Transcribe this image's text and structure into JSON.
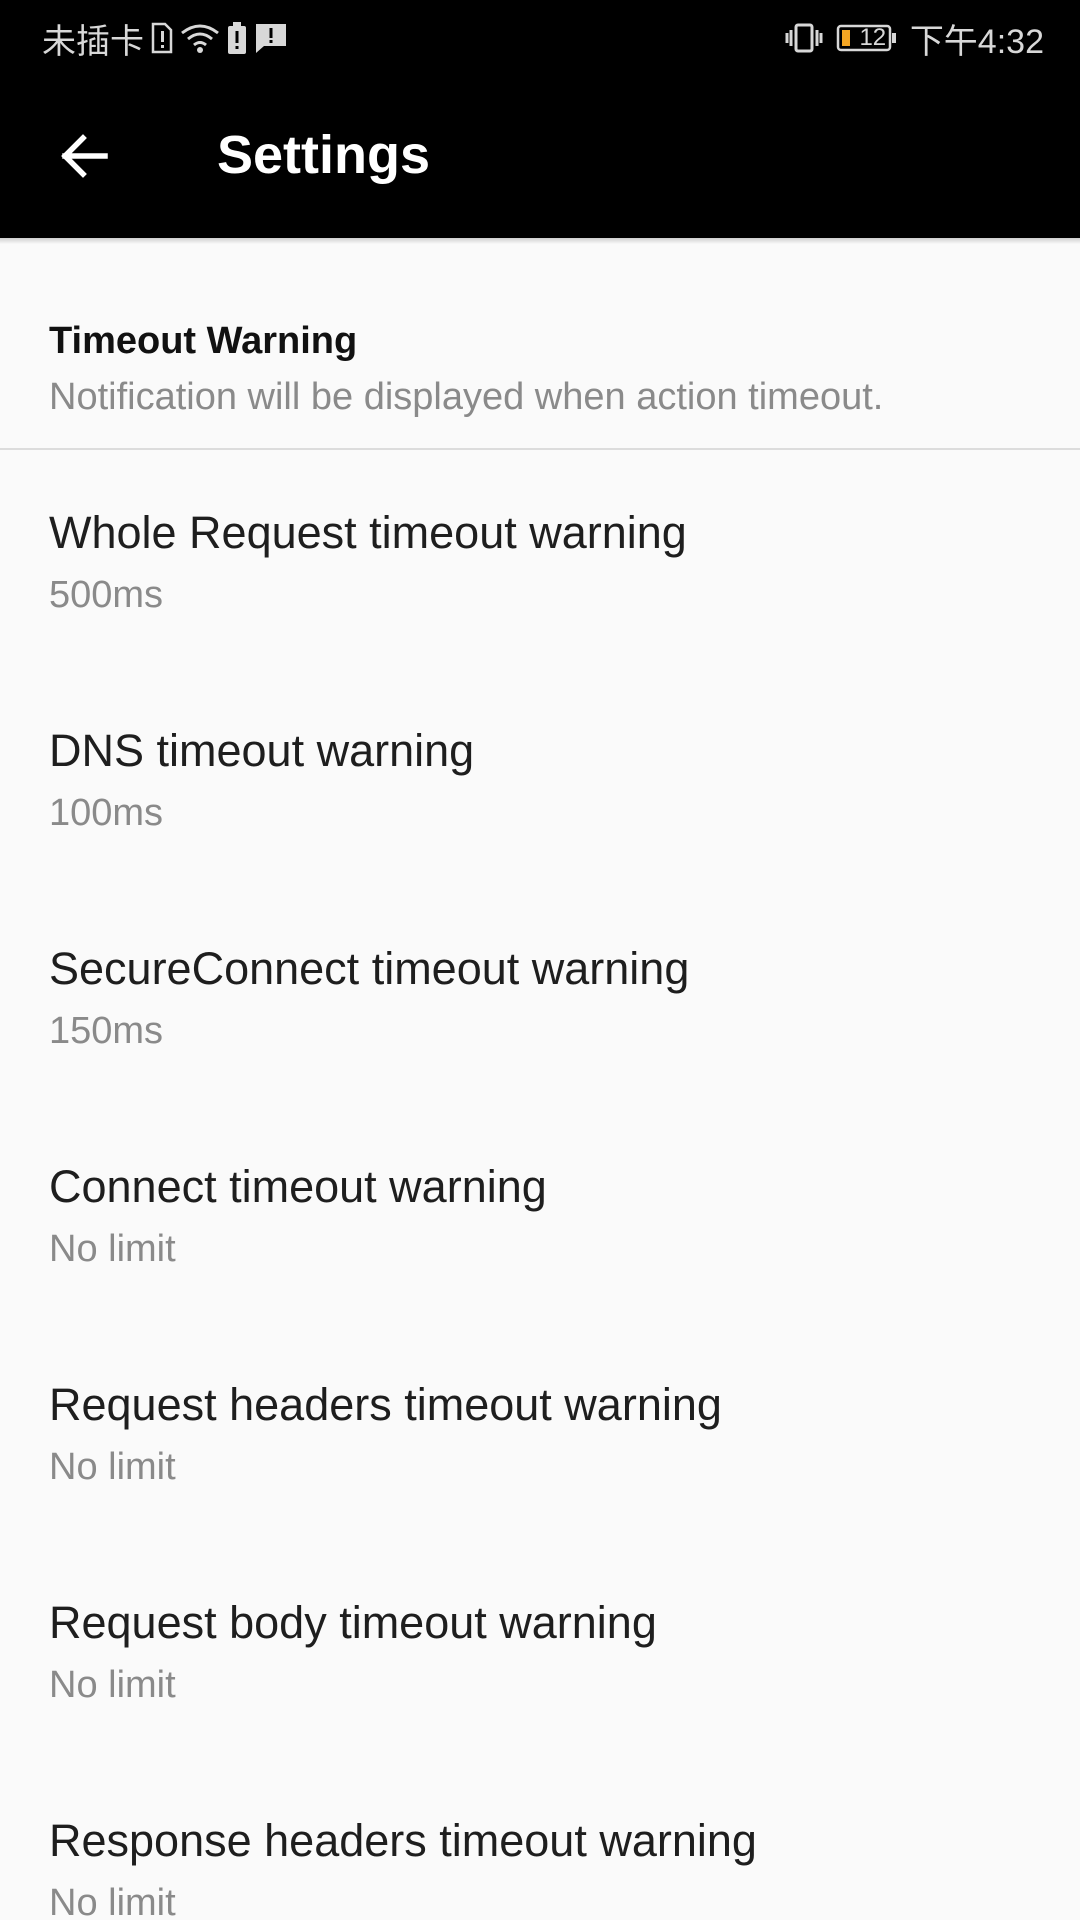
{
  "status_bar": {
    "carrier": "未插卡",
    "battery_level": "12",
    "time": "下午4:32",
    "icons": [
      "sim-missing-icon",
      "wifi-icon",
      "battery-saver-icon",
      "notification-icon",
      "vibrate-icon",
      "battery-icon"
    ],
    "battery_color": "#f5a623"
  },
  "toolbar": {
    "title": "Settings",
    "back_icon": "arrow-left-icon"
  },
  "section": {
    "title": "Timeout Warning",
    "subtitle": "Notification will be displayed when action timeout."
  },
  "settings": [
    {
      "title": "Whole Request timeout warning",
      "value": "500ms"
    },
    {
      "title": "DNS timeout warning",
      "value": "100ms"
    },
    {
      "title": "SecureConnect timeout warning",
      "value": "150ms"
    },
    {
      "title": "Connect timeout warning",
      "value": "No limit"
    },
    {
      "title": "Request headers timeout warning",
      "value": "No limit"
    },
    {
      "title": "Request body timeout warning",
      "value": "No limit"
    },
    {
      "title": "Response headers timeout warning",
      "value": "No limit"
    }
  ]
}
